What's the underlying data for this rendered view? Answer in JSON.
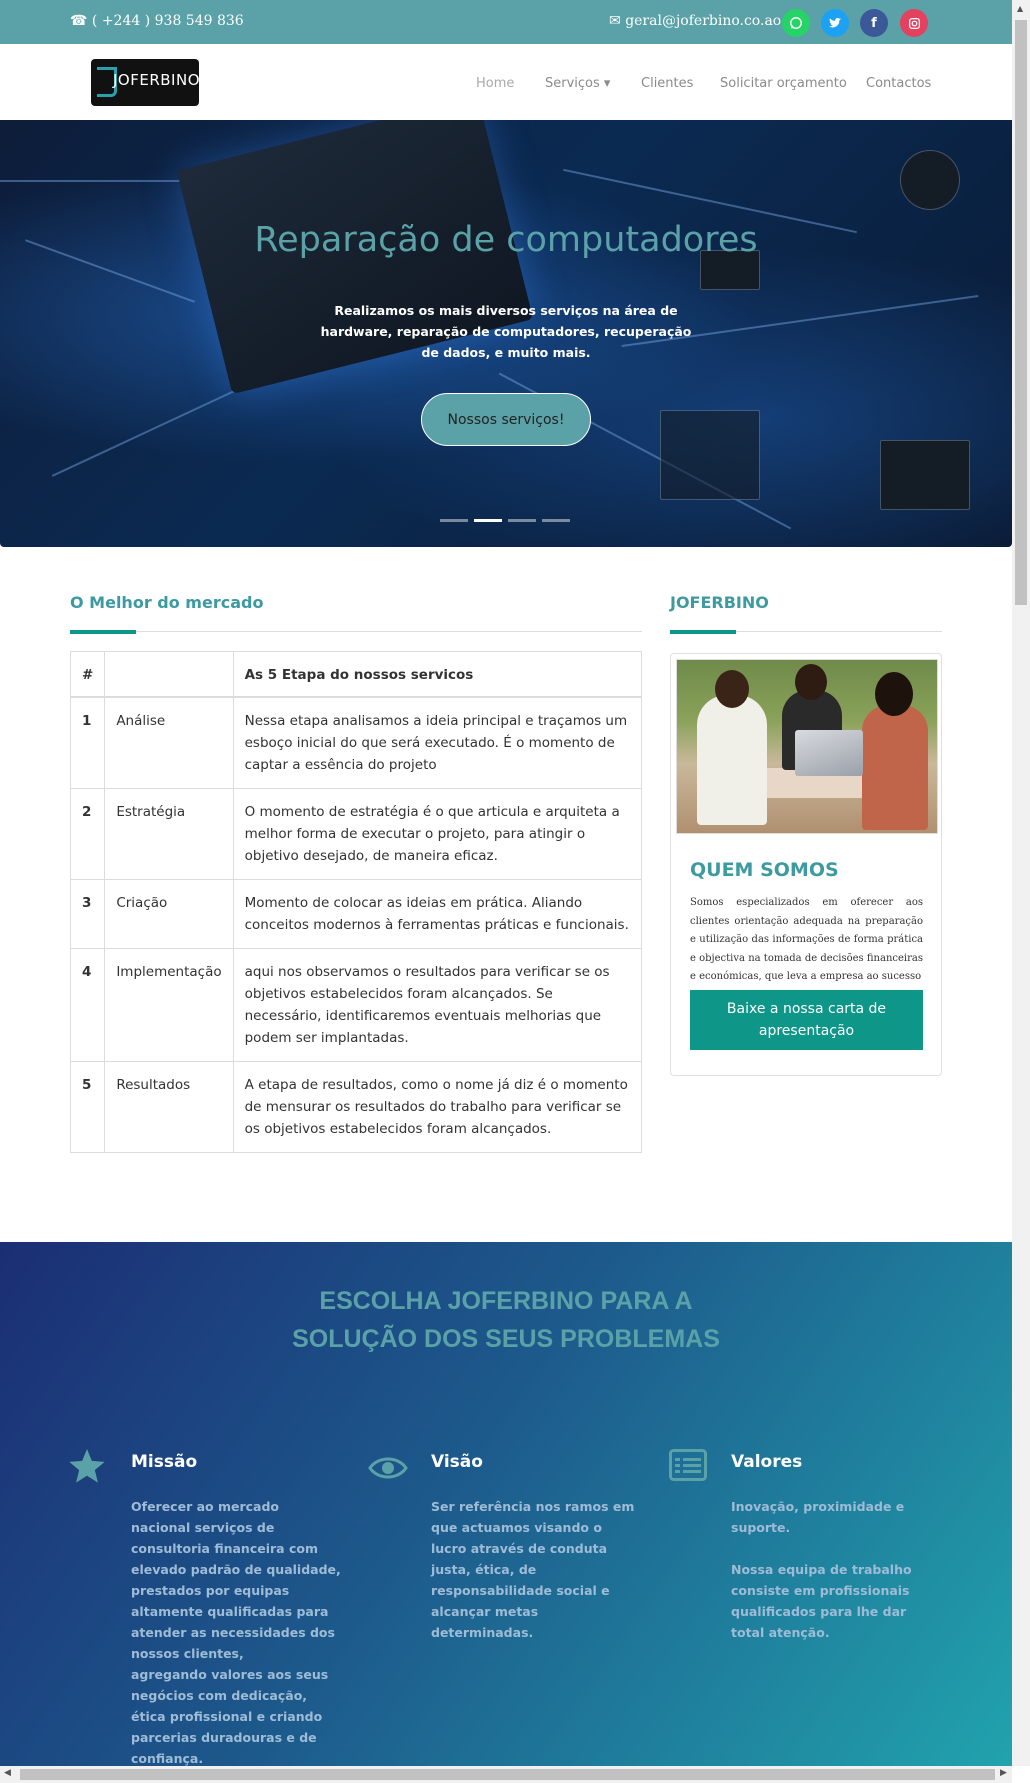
{
  "topbar": {
    "phone": "( +244 ) 938 549 836",
    "email": "geral@joferbino.co.ao",
    "social": [
      "whatsapp-icon",
      "twitter-icon",
      "facebook-icon",
      "instagram-icon"
    ]
  },
  "nav": {
    "logo_text": "JOFERBINO",
    "items": [
      "Home",
      "Serviços ▾",
      "Clientes",
      "Solicitar orçamento",
      "Contactos"
    ]
  },
  "hero": {
    "title": "Reparação de computadores",
    "subtitle": "Realizamos os mais diversos serviços na área de hardware, reparação de computadores, recuperação de dados, e muito mais.",
    "cta": "Nossos serviços!",
    "slides": 4,
    "active_slide": 2
  },
  "main": {
    "title": "O Melhor do mercado",
    "table": {
      "headers": [
        "#",
        "",
        "As 5 Etapa do nossos servicos"
      ],
      "rows": [
        {
          "num": "1",
          "step": "Análise",
          "text": "Nessa etapa analisamos a ideia principal e traçamos um esboço inicial do que será executado. É o momento de captar a essência do projeto"
        },
        {
          "num": "2",
          "step": "Estratégia",
          "text": "O momento de estratégia é o que articula e arquiteta a melhor forma de executar o projeto, para atingir o objetivo desejado, de maneira eficaz."
        },
        {
          "num": "3",
          "step": "Criação",
          "text": "Momento de colocar as ideias em prática. Aliando conceitos modernos à ferramentas práticas e funcionais."
        },
        {
          "num": "4",
          "step": "Implementação",
          "text": "aqui nos observamos o resultados para verificar se os objetivos estabelecidos foram alcançados. Se necessário, identificaremos eventuais melhorias que podem ser implantadas."
        },
        {
          "num": "5",
          "step": "Resultados",
          "text": "A etapa de resultados, como o nome já diz é o momento de mensurar os resultados do trabalho para verificar se os objetivos estabelecidos foram alcançados."
        }
      ]
    }
  },
  "aside": {
    "title": "JOFERBINO",
    "card_title": "QUEM SOMOS",
    "card_text": "Somos especializados em oferecer aos clientes orientação adequada na preparação e utilização das informações de forma prática e objectiva na tomada de decisões financeiras e económicas, que leva a empresa ao sucesso",
    "download": "Baixe a nossa carta de apresentação"
  },
  "choose": {
    "title": "ESCOLHA JOFERBINO PARA A SOLUÇÃO DOS SEUS PROBLEMAS",
    "features": [
      {
        "icon": "star-icon",
        "title": "Missão",
        "text": "Oferecer ao mercado nacional serviços de consultoria financeira com elevado padrão de qualidade, prestados por equipas altamente qualificadas para atender as necessidades dos nossos clientes,\nagregando valores aos seus negócios com dedicação, ética profissional e criando parcerias duradouras e de confiança."
      },
      {
        "icon": "eye-icon",
        "title": "Visão",
        "text": "Ser referência nos ramos em que actuamos visando o lucro através de conduta justa, ética, de\nresponsabilidade social e alcançar metas determinadas."
      },
      {
        "icon": "list-icon",
        "title": "Valores",
        "text": "Inovação, proximidade e suporte.\n\nNossa equipa de trabalho consiste em profissionais qualificados para lhe dar total atenção."
      }
    ]
  },
  "colors": {
    "brand": "#5aa2a8",
    "accent": "#0e9688",
    "gradient_start": "#1b2e74",
    "gradient_end": "#21a3ad"
  }
}
